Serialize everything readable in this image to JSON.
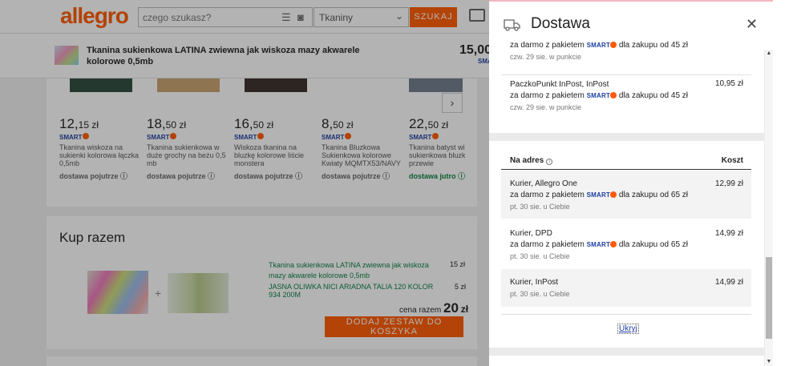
{
  "header": {
    "logo": "allegro",
    "search_placeholder": "czego szukasz?",
    "category": "Tkaniny",
    "search_button": "SZUKAJ"
  },
  "product_strip": {
    "title": "Tkanina sukienkowa LATINA zwiewna jak wiskoza mazy akwarele kolorowe 0,5mb",
    "price": "15,00",
    "smart": "SMART"
  },
  "recommendations": [
    {
      "price_main": "12,",
      "price_cents": "15 zł",
      "smart": "SMART",
      "name": "Tkanina wiskoza na sukienki kolorowa łączka 0,5mb",
      "delivery": "dostawa pojutrze",
      "fast": false,
      "color": "#2f4a3d"
    },
    {
      "price_main": "18,",
      "price_cents": "50 zł",
      "smart": "SMART",
      "name": "Tkanina sukienkowa w duże grochy na beżu 0,5 mb",
      "delivery": "dostawa pojutrze",
      "fast": false,
      "color": "#c9a26f"
    },
    {
      "price_main": "16,",
      "price_cents": "50 zł",
      "smart": "SMART",
      "name": "Wiskoza tkanina na bluzkę kolorowe liście monstera",
      "delivery": "dostawa pojutrze",
      "fast": false,
      "color": "#3a2f2a"
    },
    {
      "price_main": "8,",
      "price_cents": "50 zł",
      "smart": "SMART",
      "name": "Tkanina Bluzkowa Sukienkowa kolorowe Kwiaty MQMTX53/NAVY",
      "delivery": "dostawa pojutrze",
      "fast": false,
      "color": "#ffffff"
    },
    {
      "price_main": "22,",
      "price_cents": "50 zł",
      "smart": "SMART",
      "name": "Tkanina batyst wi 100% sukienkowa bluzkowa przewie",
      "delivery": "dostawa jutro",
      "fast": true,
      "color": "#6f7d8c"
    }
  ],
  "kup_razem": {
    "title": "Kup razem",
    "item1": "Tkanina sukienkowa LATINA zwiewna jak wiskoza mazy akwarele kolorowe 0,5mb",
    "item1_price": "15 zł",
    "item2": "JASNA OLIWKA NICI ARIADNA TALIA 120 KOLOR 934 200M",
    "item2_price": "5 zł",
    "total_label": "cena razem",
    "total_value": "20",
    "total_currency": "zł",
    "button": "DODAJ ZESTAW DO KOSZYKA"
  },
  "drawer": {
    "title": "Dostawa",
    "pickup_options": [
      {
        "name": "",
        "free_prefix": "za darmo z pakietem",
        "smart": "SMART",
        "free_suffix": "dla zakupu od 45 zł",
        "date": "czw. 29 sie. w punkcie",
        "price": ""
      },
      {
        "name": "PaczkoPunkt InPost, InPost",
        "free_prefix": "za darmo z pakietem",
        "smart": "SMART",
        "free_suffix": "dla zakupu od 45 zł",
        "date": "czw. 29 sie. w punkcie",
        "price": "10,95 zł"
      }
    ],
    "address_header": "Na adres",
    "cost_header": "Koszt",
    "address_options": [
      {
        "name": "Kurier, Allegro One",
        "free_prefix": "za darmo z pakietem",
        "smart": "SMART",
        "free_suffix": "dla zakupu od 65 zł",
        "date": "pt. 30 sie. u Ciebie",
        "price": "12,99 zł"
      },
      {
        "name": "Kurier, DPD",
        "free_prefix": "za darmo z pakietem",
        "smart": "SMART",
        "free_suffix": "dla zakupu od 65 zł",
        "date": "pt. 30 sie. u Ciebie",
        "price": "14,99 zł"
      },
      {
        "name": "Kurier, InPost",
        "free_prefix": "",
        "smart": "",
        "free_suffix": "",
        "date": "pt. 30 sie. u Ciebie",
        "price": "14,99 zł"
      }
    ],
    "hide_link": "Ukryj"
  },
  "colors": {
    "accent": "#ff5a00",
    "smart_blue": "#1d3ea1",
    "link_green": "#0b8043"
  }
}
